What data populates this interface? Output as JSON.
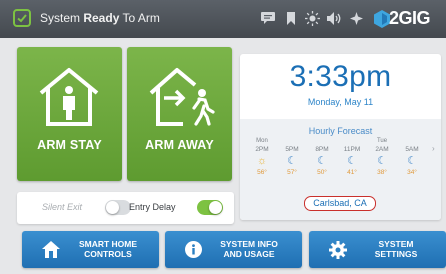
{
  "header": {
    "status_prefix": "System ",
    "status_bold": "Ready",
    "status_suffix": " To Arm",
    "brand": "2GIG",
    "icons": [
      "message-icon",
      "bookmark-icon",
      "brightness-icon",
      "volume-icon",
      "settings-wrench-icon"
    ]
  },
  "arm": {
    "stay_label": "ARM STAY",
    "away_label": "ARM AWAY"
  },
  "toggles": {
    "silent_exit_label": "Silent Exit",
    "silent_exit_on": false,
    "entry_delay_label": "Entry Delay",
    "entry_delay_on": true
  },
  "clock": {
    "time": "3:33pm",
    "date": "Monday, May 11"
  },
  "forecast": {
    "title": "Hourly Forecast",
    "columns": [
      {
        "day": "Mon",
        "time": "2PM",
        "icon": "sun-icon",
        "temp": "56°"
      },
      {
        "day": "",
        "time": "5PM",
        "icon": "moon-icon",
        "temp": "57°"
      },
      {
        "day": "",
        "time": "8PM",
        "icon": "moon-icon",
        "temp": "50°"
      },
      {
        "day": "",
        "time": "11PM",
        "icon": "moon-icon",
        "temp": "41°"
      },
      {
        "day": "Tue",
        "time": "2AM",
        "icon": "moon-icon",
        "temp": "38°"
      },
      {
        "day": "",
        "time": "5AM",
        "icon": "moon-icon",
        "temp": "34°"
      }
    ],
    "location": "Carlsbad, CA"
  },
  "bottom": {
    "smart_home": [
      "SMART HOME",
      "CONTROLS"
    ],
    "system_info": [
      "SYSTEM INFO",
      "AND USAGE"
    ],
    "system_settings": [
      "SYSTEM",
      "SETTINGS"
    ]
  },
  "colors": {
    "arm_green": "#6aa73b",
    "accent_blue": "#1b6fb5",
    "toggle_green": "#7dc242",
    "header_gray": "#4f555b",
    "location_ring": "#c9302c"
  }
}
